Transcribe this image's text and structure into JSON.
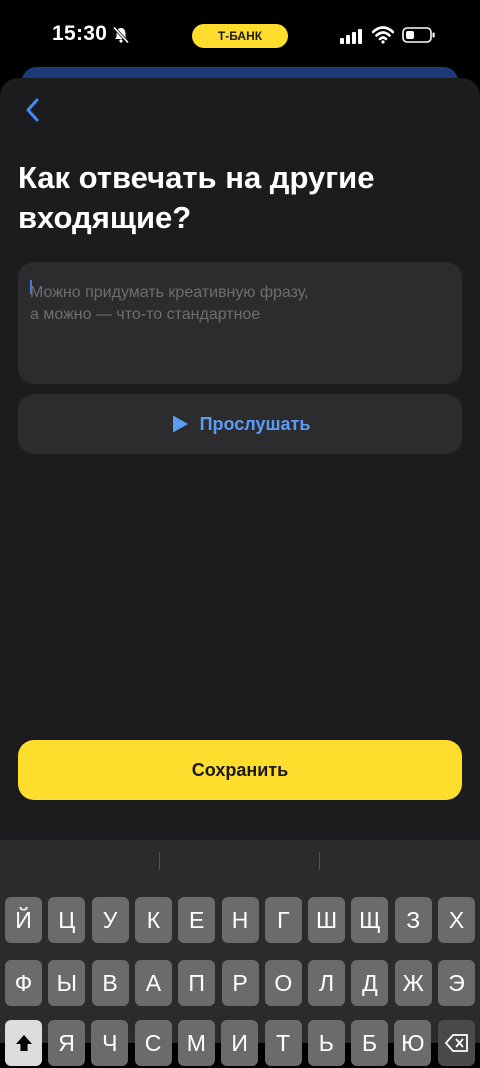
{
  "status": {
    "time": "15:30",
    "pill": "Т-БАНК"
  },
  "screen": {
    "title": "Как отвечать на другие входящие?",
    "field_placeholder": "Можно придумать креативную фразу,\nа можно — что-то стандартное",
    "listen_label": "Прослушать",
    "save_label": "Сохранить"
  },
  "keyboard": {
    "row1": [
      "Й",
      "Ц",
      "У",
      "К",
      "Е",
      "Н",
      "Г",
      "Ш",
      "Щ",
      "З",
      "Х"
    ],
    "row2": [
      "Ф",
      "Ы",
      "В",
      "А",
      "П",
      "Р",
      "О",
      "Л",
      "Д",
      "Ж",
      "Э"
    ],
    "row3": [
      "Я",
      "Ч",
      "С",
      "М",
      "И",
      "Т",
      "Ь",
      "Б",
      "Ю"
    ]
  },
  "colors": {
    "accent": "#ffdd2d",
    "link": "#5c9cf5",
    "sheet": "#1c1c1e",
    "field": "#2c2c2e"
  }
}
